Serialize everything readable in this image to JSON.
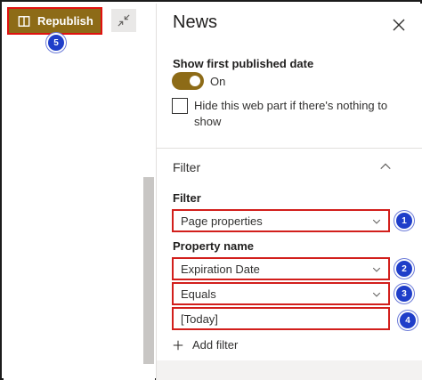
{
  "toolbar": {
    "republish_label": "Republish",
    "republish_badge": "5"
  },
  "panel": {
    "title": "News",
    "show_date_label": "Show first published date",
    "toggle_state": "On",
    "hide_label": "Hide this web part if there's nothing to show",
    "section_title": "Filter",
    "filter_label": "Filter",
    "filter_value": "Page properties",
    "property_label": "Property name",
    "property_value": "Expiration Date",
    "operator_value": "Equals",
    "value_value": "[Today]",
    "add_filter_label": "Add filter"
  },
  "badges": [
    "1",
    "2",
    "3",
    "4"
  ],
  "colors": {
    "accent": "#8d6b17",
    "highlight": "#d21f1c",
    "badge": "#1f3ec9"
  }
}
